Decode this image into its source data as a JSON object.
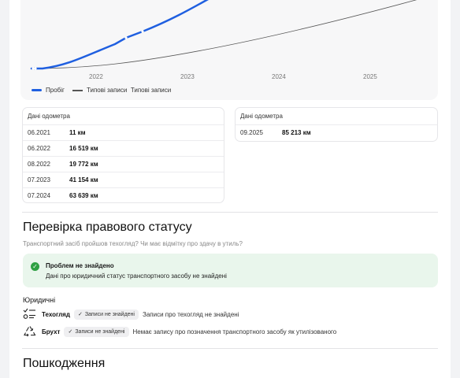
{
  "chart_data": {
    "type": "line",
    "x_ticks": [
      "2022",
      "2023",
      "2024",
      "2025"
    ],
    "series": [
      {
        "name": "Пробіг",
        "color": "#1f5fe0"
      },
      {
        "name": "Типові записи",
        "color": "#555555"
      }
    ],
    "legend": {
      "mileage": "Пробіг",
      "typical_a": "Типові записи",
      "typical_b": "Типові записи"
    },
    "grid": false,
    "legend_position": "bottom-left"
  },
  "odometer_left": {
    "header": "Дані одометра",
    "rows": [
      {
        "date": "06.2021",
        "value": "11 км"
      },
      {
        "date": "06.2022",
        "value": "16 519 км"
      },
      {
        "date": "08.2022",
        "value": "19 772 км"
      },
      {
        "date": "07.2023",
        "value": "41 154 км"
      },
      {
        "date": "07.2024",
        "value": "63 639 км"
      }
    ]
  },
  "odometer_right": {
    "header": "Дані одометра",
    "rows": [
      {
        "date": "09.2025",
        "value": "85 213 км"
      }
    ]
  },
  "legal": {
    "title": "Перевірка правового статусу",
    "subtitle": "Транспортний засіб пройшов техогляд? Чи має відмітку про здачу в утиль?",
    "ok_title": "Проблем не знайдено",
    "ok_text": "Дані про юридичний статус транспортного засобу не знайдені",
    "section_label": "Юридичні",
    "items": [
      {
        "name": "Техогляд",
        "badge": "Записи не знайдені",
        "desc": "Записи про техогляд не знайдені",
        "icon": "checklist-icon"
      },
      {
        "name": "Брухт",
        "badge": "Записи не знайдені",
        "desc": "Немає запису про позначення транспортного засобу як утилізованого",
        "icon": "recycle-icon"
      }
    ]
  },
  "damage": {
    "title": "Пошкодження"
  },
  "colors": {
    "accent": "#1f5fe0",
    "ok_bg": "#e9f6ec",
    "ok_icon": "#2ea043"
  }
}
